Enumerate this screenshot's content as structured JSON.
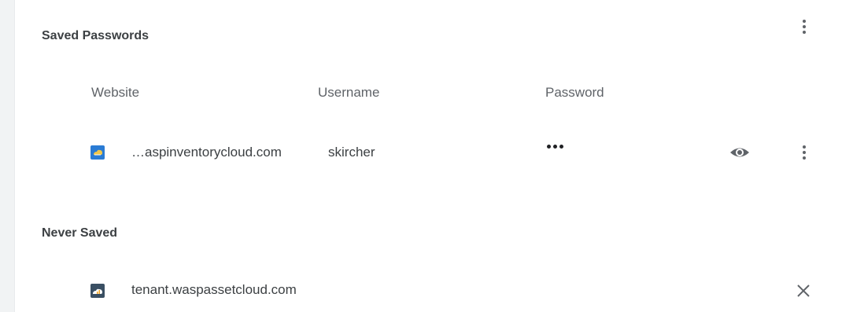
{
  "saved": {
    "title": "Saved Passwords",
    "columns": {
      "website": "Website",
      "username": "Username",
      "password": "Password"
    },
    "rows": [
      {
        "site": "…aspinventorycloud.com",
        "username": "skircher",
        "password_masked": "•••",
        "favicon": "cloud-inventory-favicon"
      }
    ],
    "menu_icon": "more-vert-icon",
    "eye_icon": "eye-icon"
  },
  "never": {
    "title": "Never Saved",
    "rows": [
      {
        "site": "tenant.waspassetcloud.com",
        "favicon": "cloud-asset-favicon",
        "remove_icon": "close-icon"
      }
    ]
  },
  "colors": {
    "background": "#ffffff",
    "text": "#202124",
    "muted": "#5f6368",
    "icon": "#5f6368"
  }
}
